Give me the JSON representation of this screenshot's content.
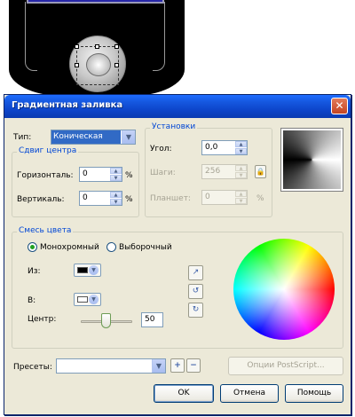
{
  "dialog": {
    "title": "Градиентная заливка",
    "close_glyph": "✕"
  },
  "type": {
    "label": "Тип:",
    "selected": "Коническая"
  },
  "center_offset": {
    "title": "Сдвиг центра",
    "horizontal_label": "Горизонталь:",
    "horizontal_value": "0",
    "vertical_label": "Вертикаль:",
    "vertical_value": "0",
    "unit": "%"
  },
  "options": {
    "title": "Установки",
    "angle_label": "Угол:",
    "angle_value": "0,0",
    "steps_label": "Шаги:",
    "steps_value": "256",
    "edge_pad_label": "Планшет:",
    "edge_pad_value": "0",
    "edge_pad_unit": "%"
  },
  "color_blend": {
    "title": "Смесь цвета",
    "mode_two_color": "Монохромный",
    "mode_custom": "Выборочный",
    "from_label": "Из:",
    "to_label": "В:",
    "from_color": "#000000",
    "to_color": "#ffffff",
    "midpoint_label": "Центр:",
    "midpoint_value": "50"
  },
  "presets": {
    "label": "Пресеты:",
    "value": "",
    "postscript_button": "Опции PostScript..."
  },
  "buttons": {
    "ok": "OK",
    "cancel": "Отмена",
    "help": "Помощь"
  },
  "tool_glyphs": {
    "direct": "↗",
    "ccw": "↺",
    "cw": "↻",
    "add": "+",
    "remove": "−",
    "lock": "🔒"
  }
}
